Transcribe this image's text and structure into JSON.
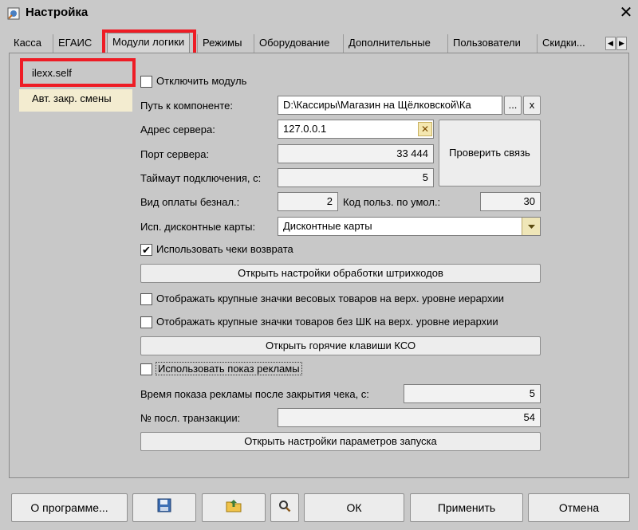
{
  "window": {
    "title": "Настройка",
    "close_glyph": "✕",
    "icon": "settings-app-icon"
  },
  "tabs": [
    {
      "label": "Касса"
    },
    {
      "label": "ЕГАИС"
    },
    {
      "label": "Модули логики",
      "active": true
    },
    {
      "label": "Режимы"
    },
    {
      "label": "Оборудование"
    },
    {
      "label": "Дополнительные"
    },
    {
      "label": "Пользователи"
    },
    {
      "label": "Скидки..."
    }
  ],
  "tab_arrows": {
    "left": "◀",
    "right": "▶"
  },
  "modules": [
    {
      "label": "ilexx.self",
      "selected": true
    },
    {
      "label": "Авт. закр. смены"
    }
  ],
  "form": {
    "disable_module": {
      "label": "Отключить модуль",
      "checked": false
    },
    "component_path": {
      "label": "Путь к компоненте:",
      "value": "D:\\Кассиры\\Магазин на Щёлковской\\Ка",
      "browse": "...",
      "clear": "x"
    },
    "server_address": {
      "label": "Адрес сервера:",
      "value": "127.0.0.1",
      "clear": "✕"
    },
    "server_port": {
      "label": "Порт сервера:",
      "value": "33 444"
    },
    "check_connection": "Проверить связь",
    "timeout": {
      "label": "Таймаут подключения, с:",
      "value": "5"
    },
    "noncash_type": {
      "label": "Вид оплаты безнал.:",
      "value": "2"
    },
    "default_user_code": {
      "label": "Код польз. по умол.:",
      "value": "30"
    },
    "discount_cards": {
      "label": "Исп. дисконтные карты:",
      "value": "Дисконтные карты"
    },
    "use_return_receipts": {
      "label": "Использовать чеки возврата",
      "checked": true
    },
    "barcode_settings": "Открыть настройки обработки штрихкодов",
    "large_weight_icons": {
      "label": "Отображать крупные значки весовых товаров на верх. уровне иерархии",
      "checked": false
    },
    "large_nobarcode_icons": {
      "label": "Отображать крупные значки товаров без ШК на верх. уровне иерархии",
      "checked": false
    },
    "hotkeys": "Открыть горячие клавиши КСО",
    "show_ads": {
      "label": "Использовать показ рекламы",
      "checked": false
    },
    "ad_time": {
      "label": "Время показа рекламы после закрытия чека, с:",
      "value": "5"
    },
    "last_transaction": {
      "label": "№ посл. транзакции:",
      "value": "54"
    },
    "launch_params": "Открыть настройки параметров запуска"
  },
  "footer": {
    "about": "О программе...",
    "ok": "ОК",
    "apply": "Применить",
    "cancel": "Отмена"
  },
  "colors": {
    "highlight": "#ee1c25",
    "selected_item_bg": "#f3ecd0",
    "window_bg": "#c9c9c9"
  }
}
